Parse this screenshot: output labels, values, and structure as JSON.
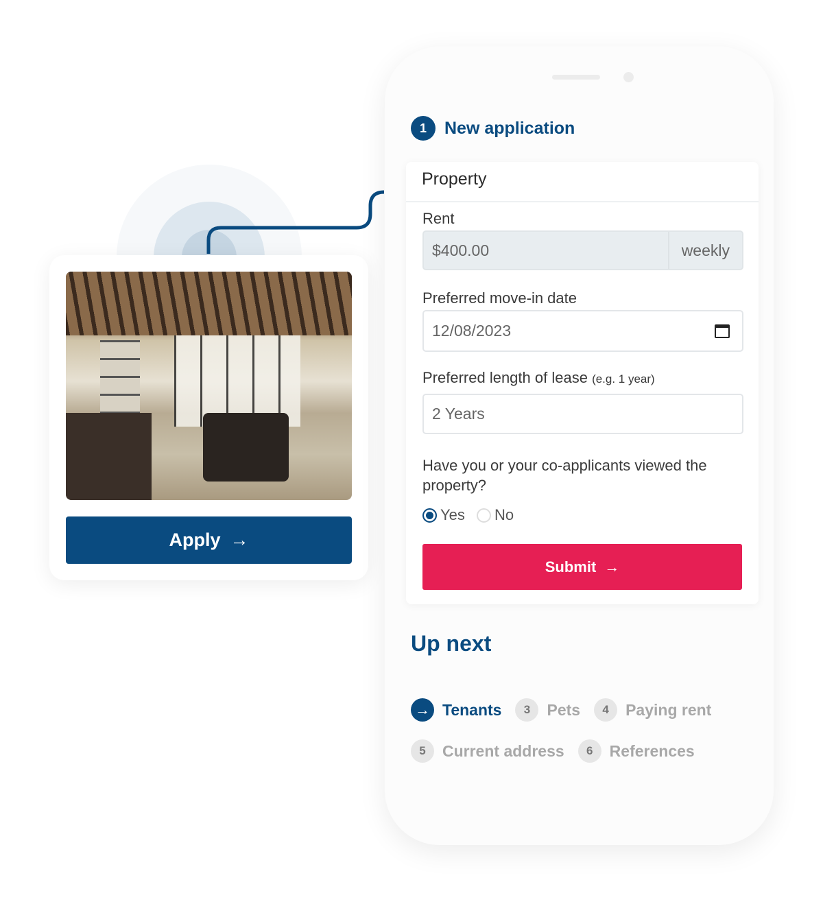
{
  "listing": {
    "apply_label": "Apply",
    "arrow": "→"
  },
  "application": {
    "step_number": "1",
    "title": "New application",
    "section": "Property",
    "rent": {
      "label": "Rent",
      "value": "$400.00",
      "period": "weekly"
    },
    "move_in": {
      "label": "Preferred move-in date",
      "value": "12/08/2023"
    },
    "lease": {
      "label": "Preferred length of lease",
      "hint": "(e.g. 1 year)",
      "value": "2 Years"
    },
    "viewed": {
      "question": "Have you or your co-applicants viewed the property?",
      "options": [
        "Yes",
        "No"
      ],
      "selected": "Yes"
    },
    "submit_label": "Submit"
  },
  "up_next": {
    "title": "Up next",
    "steps": [
      {
        "num": "→",
        "label": "Tenants",
        "active": true
      },
      {
        "num": "3",
        "label": "Pets"
      },
      {
        "num": "4",
        "label": "Paying rent"
      },
      {
        "num": "5",
        "label": "Current address"
      },
      {
        "num": "6",
        "label": "References"
      }
    ]
  },
  "colors": {
    "brand": "#0a4b80",
    "submit": "#e61f54"
  }
}
